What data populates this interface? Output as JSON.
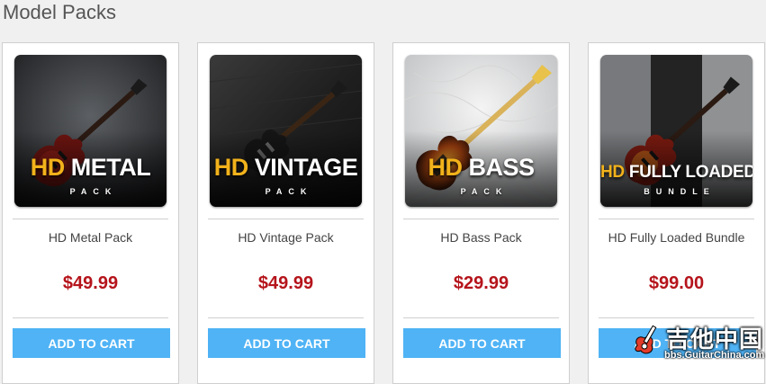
{
  "section": {
    "title": "Model Packs"
  },
  "colors": {
    "price": "#b5141b",
    "button": "#4fb3f5",
    "hd_gold": "#f2b21b"
  },
  "products": [
    {
      "thumb_hd": "HD",
      "thumb_main": "METAL",
      "thumb_sub": "PACK",
      "name": "HD Metal Pack",
      "price": "$49.99",
      "button": "ADD TO CART"
    },
    {
      "thumb_hd": "HD",
      "thumb_main": "VINTAGE",
      "thumb_sub": "PACK",
      "name": "HD Vintage Pack",
      "price": "$49.99",
      "button": "ADD TO CART"
    },
    {
      "thumb_hd": "HD",
      "thumb_main": "BASS",
      "thumb_sub": "PACK",
      "name": "HD Bass Pack",
      "price": "$29.99",
      "button": "ADD TO CART"
    },
    {
      "thumb_hd": "HD",
      "thumb_main": "FULLY LOADED",
      "thumb_sub": "BUNDLE",
      "name": "HD Fully Loaded Bundle",
      "price": "$99.00",
      "button": "ADD TO CART"
    }
  ],
  "watermark": {
    "text": "吉他中国",
    "url": "bbs.GuitarChina.com"
  }
}
